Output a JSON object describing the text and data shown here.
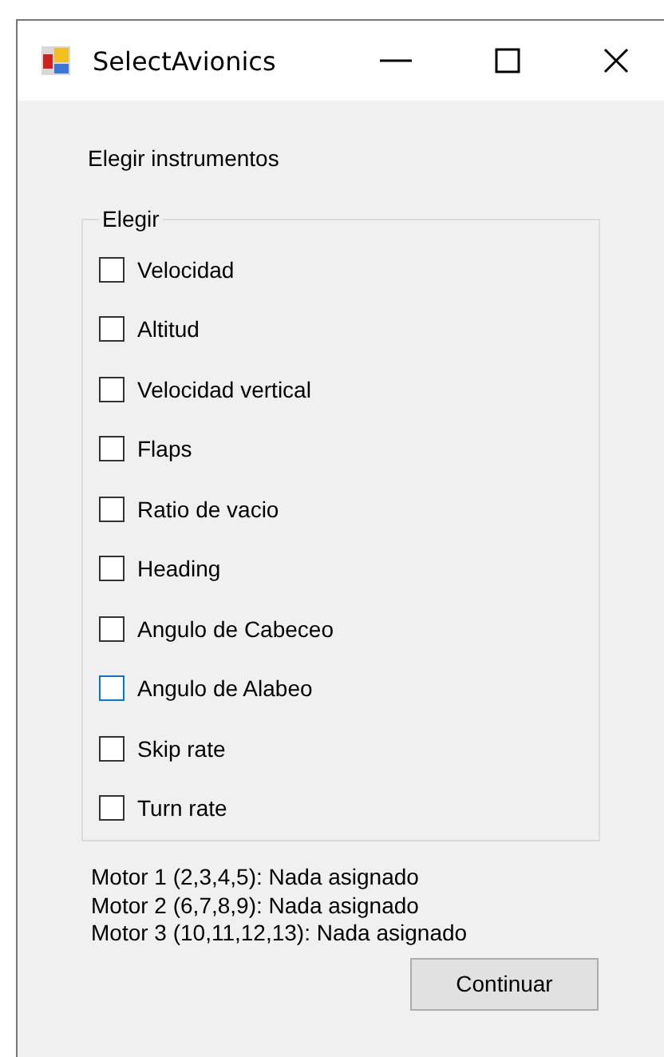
{
  "window": {
    "title": "SelectAvionics"
  },
  "heading": "Elegir instrumentos",
  "group": {
    "legend": "Elegir",
    "items": [
      {
        "label": "Velocidad",
        "checked": false,
        "focused": false
      },
      {
        "label": "Altitud",
        "checked": false,
        "focused": false
      },
      {
        "label": "Velocidad vertical",
        "checked": false,
        "focused": false
      },
      {
        "label": "Flaps",
        "checked": false,
        "focused": false
      },
      {
        "label": "Ratio de vacio",
        "checked": false,
        "focused": false
      },
      {
        "label": "Heading",
        "checked": false,
        "focused": false
      },
      {
        "label": "Angulo de Cabeceo",
        "checked": false,
        "focused": false
      },
      {
        "label": "Angulo de Alabeo",
        "checked": false,
        "focused": true
      },
      {
        "label": "Skip rate",
        "checked": false,
        "focused": false
      },
      {
        "label": "Turn rate",
        "checked": false,
        "focused": false
      }
    ]
  },
  "motors": [
    "Motor 1 (2,3,4,5): Nada asignado",
    "Motor 2 (6,7,8,9): Nada asignado",
    "Motor 3 (10,11,12,13): Nada asignado"
  ],
  "buttons": [
    "Continuar"
  ]
}
